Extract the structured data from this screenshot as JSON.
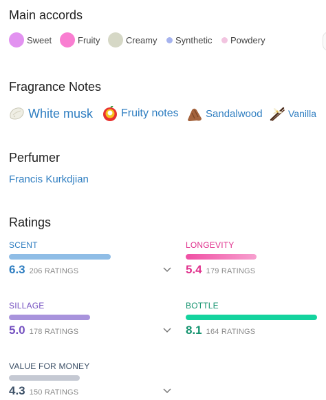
{
  "main_accords": {
    "title": "Main accords",
    "items": [
      {
        "label": "Sweet",
        "color": "#e292f0"
      },
      {
        "label": "Fruity",
        "color": "#f97ed1"
      },
      {
        "label": "Creamy",
        "color": "#d6d8c6"
      },
      {
        "label": "Synthetic",
        "color": "#a6b3ee"
      },
      {
        "label": "Powdery",
        "color": "#f2c4e0"
      }
    ]
  },
  "fragrance_notes": {
    "title": "Fragrance Notes",
    "items": [
      {
        "label": "White musk",
        "icon": "white-musk-icon"
      },
      {
        "label": "Fruity notes",
        "icon": "fruity-notes-icon"
      },
      {
        "label": "Sandalwood",
        "icon": "sandalwood-icon"
      },
      {
        "label": "Vanilla",
        "icon": "vanilla-icon"
      }
    ]
  },
  "perfumer": {
    "title": "Perfumer",
    "name": "Francis Kurkdjian"
  },
  "ratings": {
    "title": "Ratings",
    "items": [
      {
        "name": "SCENT",
        "value": "6.3",
        "count": "206 RATINGS",
        "level": 0.63,
        "color": "#2f7ec1",
        "bar_color": "#8fbde6",
        "expandable": true
      },
      {
        "name": "LONGEVITY",
        "value": "5.4",
        "count": "179 RATINGS",
        "level": 0.54,
        "color": "#e0318d",
        "bar_color": "#f04fa4",
        "expandable": false
      },
      {
        "name": "SILLAGE",
        "value": "5.0",
        "count": "178 RATINGS",
        "level": 0.5,
        "color": "#7450c0",
        "bar_color": "#a893dc",
        "expandable": true
      },
      {
        "name": "BOTTLE",
        "value": "8.1",
        "count": "164 RATINGS",
        "level": 0.81,
        "color": "#15936f",
        "bar_color": "#14d39e",
        "expandable": false
      },
      {
        "name": "VALUE FOR MONEY",
        "value": "4.3",
        "count": "150 RATINGS",
        "level": 0.43,
        "color": "#3b4f66",
        "bar_color": "#c5c9d3",
        "expandable": true
      }
    ]
  }
}
